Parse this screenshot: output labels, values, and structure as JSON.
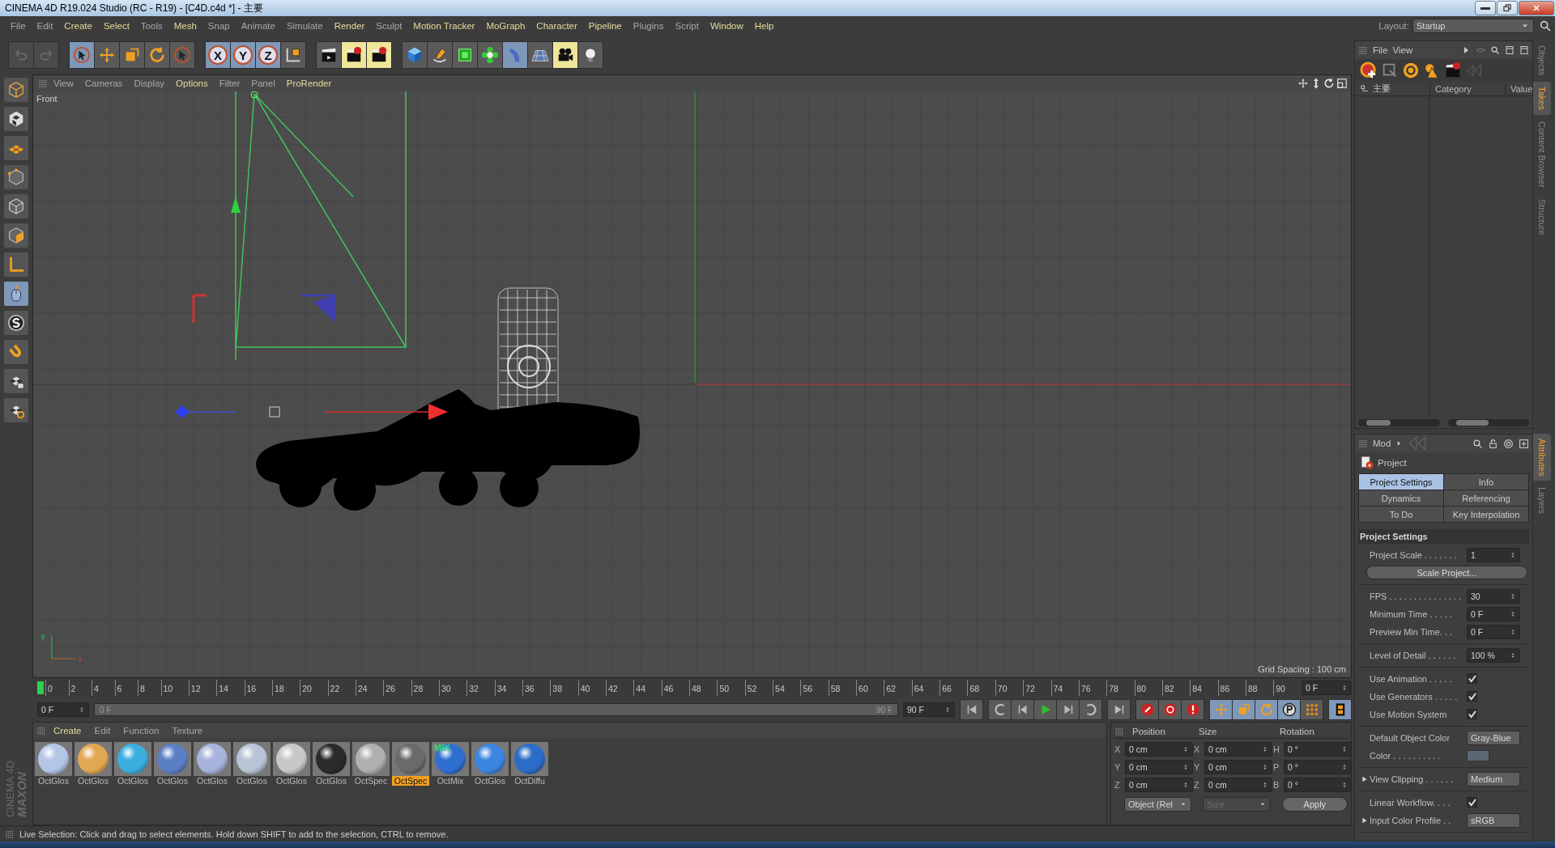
{
  "window": {
    "title": "CINEMA 4D R19.024 Studio (RC - R19) - [C4D.c4d *] - 主要"
  },
  "menu": [
    {
      "label": "File",
      "accent": false
    },
    {
      "label": "Edit",
      "accent": false
    },
    {
      "label": "Create",
      "accent": true
    },
    {
      "label": "Select",
      "accent": true
    },
    {
      "label": "Tools",
      "accent": false
    },
    {
      "label": "Mesh",
      "accent": true
    },
    {
      "label": "Snap",
      "accent": false
    },
    {
      "label": "Animate",
      "accent": false
    },
    {
      "label": "Simulate",
      "accent": false
    },
    {
      "label": "Render",
      "accent": true
    },
    {
      "label": "Sculpt",
      "accent": false
    },
    {
      "label": "Motion Tracker",
      "accent": true
    },
    {
      "label": "MoGraph",
      "accent": true
    },
    {
      "label": "Character",
      "accent": true
    },
    {
      "label": "Pipeline",
      "accent": true
    },
    {
      "label": "Plugins",
      "accent": false
    },
    {
      "label": "Script",
      "accent": false
    },
    {
      "label": "Window",
      "accent": true
    },
    {
      "label": "Help",
      "accent": true
    }
  ],
  "layout": {
    "label": "Layout:",
    "value": "Startup"
  },
  "axis_buttons": [
    "X",
    "Y",
    "Z"
  ],
  "viewport": {
    "menu": [
      {
        "label": "View",
        "accent": false
      },
      {
        "label": "Cameras",
        "accent": false
      },
      {
        "label": "Display",
        "accent": false
      },
      {
        "label": "Options",
        "accent": true
      },
      {
        "label": "Filter",
        "accent": false
      },
      {
        "label": "Panel",
        "accent": false
      },
      {
        "label": "ProRender",
        "accent": true
      }
    ],
    "view_label": "Front",
    "grid_spacing": "Grid Spacing : 100 cm",
    "axis_labels": [
      "y",
      "x"
    ]
  },
  "timeline": {
    "ticks": [
      "0",
      "2",
      "4",
      "6",
      "8",
      "10",
      "12",
      "14",
      "16",
      "18",
      "20",
      "22",
      "24",
      "26",
      "28",
      "30",
      "32",
      "34",
      "36",
      "38",
      "40",
      "42",
      "44",
      "46",
      "48",
      "50",
      "52",
      "54",
      "56",
      "58",
      "60",
      "62",
      "64",
      "66",
      "68",
      "70",
      "72",
      "74",
      "76",
      "78",
      "80",
      "82",
      "84",
      "86",
      "88",
      "90"
    ],
    "current_frame": "0 F",
    "range_slider": {
      "level": 1
    },
    "start_field": "0 F",
    "range_start": "0 F",
    "range_end": "90 F",
    "end_field": "90 F"
  },
  "materials": {
    "menu": [
      {
        "label": "Create",
        "accent": true
      },
      {
        "label": "Edit",
        "accent": false
      },
      {
        "label": "Function",
        "accent": false
      },
      {
        "label": "Texture",
        "accent": false
      }
    ],
    "items": [
      {
        "label": "OctGlos",
        "color": "#b4c6e6",
        "selected": false
      },
      {
        "label": "OctGlos",
        "color": "#e2a752",
        "selected": false
      },
      {
        "label": "OctGlos",
        "color": "#3aaedf",
        "selected": false
      },
      {
        "label": "OctGlos",
        "color": "#5a7fc4",
        "selected": false
      },
      {
        "label": "OctGlos",
        "color": "#a8b4dc",
        "selected": false
      },
      {
        "label": "OctGlos",
        "color": "#b9c4d6",
        "selected": false
      },
      {
        "label": "OctGlos",
        "color": "#c8c8c8",
        "selected": false
      },
      {
        "label": "OctGlos",
        "color": "#2a2a2a",
        "selected": false
      },
      {
        "label": "OctSpec",
        "color": "#b0b0b0",
        "selected": false
      },
      {
        "label": "OctSpec",
        "color": "#6a6a6a",
        "selected": true
      },
      {
        "label": "OctMix",
        "color": "#2f6fd0",
        "selected": false,
        "badge": "MIX"
      },
      {
        "label": "OctGlos",
        "color": "#3a86e0",
        "selected": false
      },
      {
        "label": "OctDiffu",
        "color": "#2b6cc8",
        "selected": false
      }
    ]
  },
  "coordinates": {
    "headers": [
      "Position",
      "Size",
      "Rotation"
    ],
    "rows": [
      {
        "axis": "X",
        "position": "0 cm",
        "size_axis": "X",
        "size": "0 cm",
        "rotation_axis": "H",
        "rotation": "0 °"
      },
      {
        "axis": "Y",
        "position": "0 cm",
        "size_axis": "Y",
        "size": "0 cm",
        "rotation_axis": "P",
        "rotation": "0 °"
      },
      {
        "axis": "Z",
        "position": "0 cm",
        "size_axis": "Z",
        "size": "0 cm",
        "rotation_axis": "B",
        "rotation": "0 °"
      }
    ],
    "mode": "Object (Rel",
    "size_mode": {
      "label": "Size",
      "disabled": true
    },
    "apply": "Apply"
  },
  "logo": [
    "MAXON",
    "CINEMA 4D"
  ],
  "status_bar": "Live Selection: Click and drag to select elements. Hold down SHIFT to add to the selection, CTRL to remove.",
  "objects_panel": {
    "menu": [
      "File",
      "View"
    ],
    "tree": [
      {
        "label": "主要"
      }
    ],
    "columns": [
      "Category",
      "Value"
    ]
  },
  "side_tabs_top": [
    {
      "label": "Objects",
      "selected": false
    },
    {
      "label": "Takes",
      "selected": true
    },
    {
      "label": "Content Browser",
      "selected": false
    },
    {
      "label": "Structure",
      "selected": false
    }
  ],
  "side_tabs_bottom": [
    {
      "label": "Attributes",
      "selected": true
    },
    {
      "label": "Layers",
      "selected": false
    }
  ],
  "attributes": {
    "menu": "Mod",
    "object": "Project",
    "tabs": [
      {
        "label": "Project Settings",
        "selected": true
      },
      {
        "label": "Info",
        "selected": false
      },
      {
        "label": "Dynamics",
        "selected": false
      },
      {
        "label": "Referencing",
        "selected": false
      },
      {
        "label": "To Do",
        "selected": false
      },
      {
        "label": "Key Interpolation",
        "selected": false
      }
    ],
    "section": "Project Settings",
    "groups": [
      [
        {
          "kind": "field",
          "label": "Project Scale . . . . . . .",
          "value": "1"
        },
        {
          "kind": "button",
          "label": "Scale Project..."
        }
      ],
      [
        {
          "kind": "field",
          "label": "FPS . . . . . . . . . . . . . . .",
          "value": "30"
        },
        {
          "kind": "field",
          "label": "Minimum Time . . . . .",
          "value": "0 F"
        },
        {
          "kind": "field",
          "label": "Preview Min Time. . .",
          "value": "0 F"
        }
      ],
      [
        {
          "kind": "field",
          "label": "Level of Detail . . . . . .",
          "value": "100 %"
        }
      ],
      [
        {
          "kind": "checkbox",
          "label": "Use Animation . . . . .",
          "checked": true
        },
        {
          "kind": "checkbox",
          "label": "Use Generators . . . . .",
          "checked": true
        },
        {
          "kind": "checkbox",
          "label": "Use Motion System",
          "checked": true
        }
      ],
      [
        {
          "kind": "dropdown",
          "label": "Default Object Color",
          "value": "Gray-Blue"
        },
        {
          "kind": "color",
          "label": "Color . . . . . . . . . .",
          "color": "#5b6673"
        }
      ],
      [
        {
          "kind": "dropdown",
          "label": "View Clipping . . . . . .",
          "value": "Medium",
          "expander": true
        }
      ],
      [
        {
          "kind": "checkbox",
          "label": "Linear Workflow. . . .",
          "checked": true
        },
        {
          "kind": "dropdown",
          "label": "Input Color Profile . .",
          "value": "sRGB",
          "expander": true
        }
      ]
    ]
  }
}
